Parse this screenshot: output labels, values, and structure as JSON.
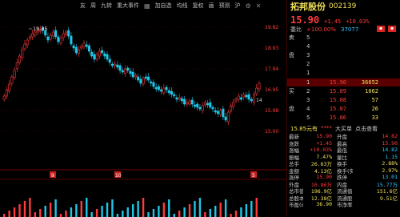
{
  "toolbar": {
    "items": [
      "友",
      "周",
      "九转",
      "重大事件",
      "加自选",
      "均线",
      "复权",
      "画",
      "预测",
      "沪"
    ]
  },
  "chart": {
    "high_label": "19.85",
    "price_axis": [
      "19.82",
      "18.93",
      "17.94",
      "16.95",
      "15.98",
      "15.00"
    ],
    "last_marker": "14",
    "date_markers": [
      "9",
      "10",
      "5"
    ],
    "colors": {
      "up": "#ff3b3b",
      "down": "#1ec7e8",
      "grid": "#3a0000"
    }
  },
  "quote": {
    "name": "拓邦股份",
    "code": "002139",
    "price": "15.90",
    "change": "+1.45",
    "change_pct": "+10.03%",
    "weibi_label": "委比",
    "weibi_value": "+100.00%",
    "weicha_value": "37077",
    "sells": [
      {
        "label": "卖",
        "num": "5",
        "px": "",
        "vol": ""
      },
      {
        "label": "",
        "num": "4",
        "px": "",
        "vol": ""
      },
      {
        "label": "盘",
        "num": "3",
        "px": "",
        "vol": ""
      },
      {
        "label": "",
        "num": "2",
        "px": "",
        "vol": ""
      },
      {
        "label": "",
        "num": "1",
        "px": "",
        "vol": ""
      }
    ],
    "buys": [
      {
        "label": "",
        "num": "1",
        "px": "15.90",
        "vol": "36652"
      },
      {
        "label": "买",
        "num": "2",
        "px": "15.89",
        "vol": "1062"
      },
      {
        "label": "",
        "num": "3",
        "px": "15.88",
        "vol": "57"
      },
      {
        "label": "盘",
        "num": "4",
        "px": "15.87",
        "vol": "26"
      },
      {
        "label": "",
        "num": "5",
        "px": "15.86",
        "vol": "33"
      }
    ],
    "limit_title": {
      "a": "15.85元有",
      "b": "****",
      "c": "大买单",
      "d": "点击查看"
    },
    "stats": [
      [
        "最新",
        "15.90",
        "开盘",
        "14.82"
      ],
      [
        "涨跌",
        "+1.45",
        "最高",
        "15.90"
      ],
      [
        "涨幅",
        "+10.03%",
        "最低",
        "14.82"
      ],
      [
        "振幅",
        "7.47%",
        "量比",
        "1.15"
      ],
      [
        "总手",
        "26.63万",
        "换手",
        "2.88%"
      ],
      [
        "金额",
        "4.13亿",
        "换手(实)",
        "2.97%"
      ],
      [
        "涨停",
        "15.90",
        "跌停",
        "13.01"
      ],
      [
        "外盘",
        "10.86万",
        "内盘",
        "15.77万"
      ],
      [
        "总市值",
        "196.9亿",
        "流通值",
        "151.6亿"
      ],
      [
        "总股本",
        "12.38亿",
        "流通股",
        "9.51亿"
      ],
      [
        "市盈(动)",
        "36.90",
        "市净率",
        ""
      ]
    ]
  }
}
